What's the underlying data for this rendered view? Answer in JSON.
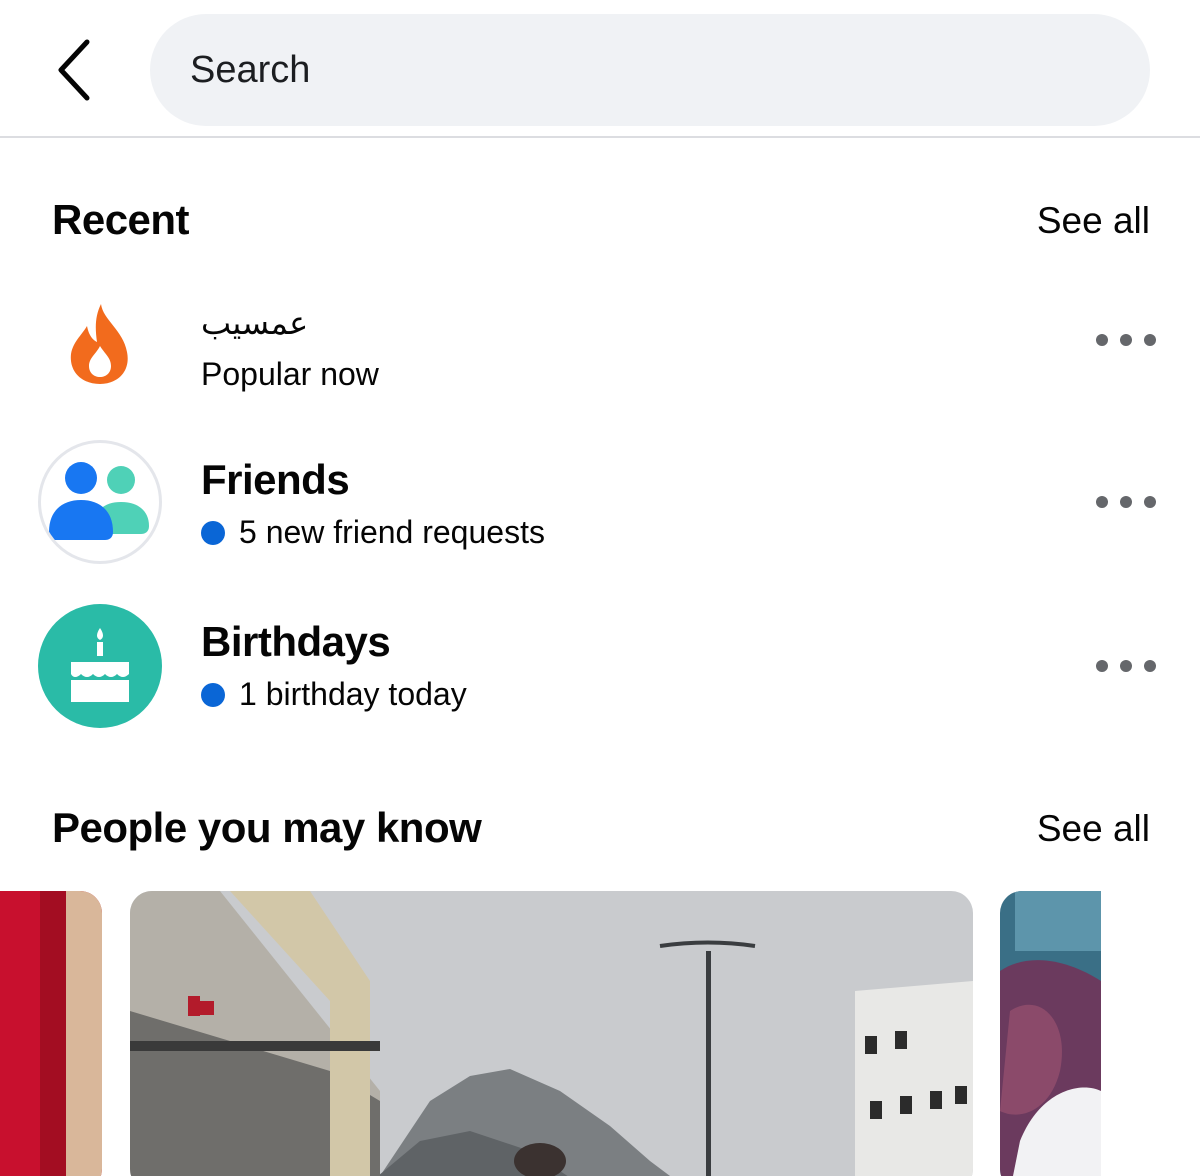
{
  "search": {
    "placeholder": "Search"
  },
  "recent": {
    "heading": "Recent",
    "see_all": "See all",
    "items": [
      {
        "title": "عمسيب",
        "subtitle": "Popular now",
        "icon": "fire-icon",
        "accent": "#f26b1d"
      },
      {
        "title": "Friends",
        "subtitle": "5 new friend requests",
        "icon": "friends-icon",
        "accent": "#1877f2"
      },
      {
        "title": "Birthdays",
        "subtitle": "1 birthday today",
        "icon": "birthday-cake-icon",
        "accent": "#2abba7"
      }
    ]
  },
  "people": {
    "heading": "People you may know",
    "see_all": "See all"
  },
  "colors": {
    "notification_dot": "#0a66d6",
    "search_bg": "#f0f2f5"
  }
}
